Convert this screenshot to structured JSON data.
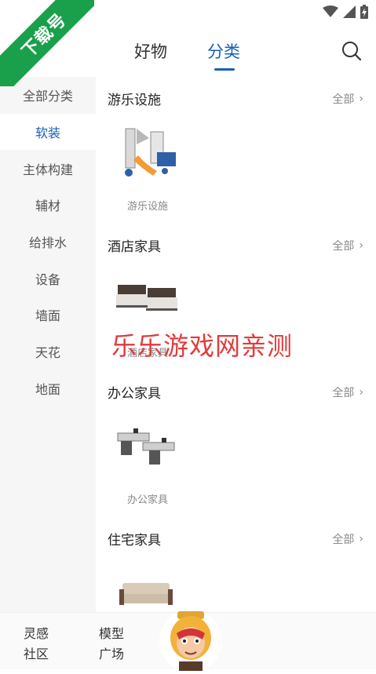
{
  "ribbon": {
    "text": "下载号",
    "color": "#1aa04a"
  },
  "status_bar": {
    "icons": [
      "wifi-icon",
      "signal-icon",
      "battery-charging-icon"
    ]
  },
  "top_tabs": [
    {
      "label": "好物",
      "active": false
    },
    {
      "label": "分类",
      "active": true
    }
  ],
  "accent_color": "#1760b8",
  "sidebar": {
    "items": [
      {
        "label": "全部分类",
        "active": false
      },
      {
        "label": "软装",
        "active": true
      },
      {
        "label": "主体构建",
        "active": false
      },
      {
        "label": "辅材",
        "active": false
      },
      {
        "label": "给排水",
        "active": false
      },
      {
        "label": "设备",
        "active": false
      },
      {
        "label": "墙面",
        "active": false
      },
      {
        "label": "天花",
        "active": false
      },
      {
        "label": "地面",
        "active": false
      }
    ]
  },
  "sections": [
    {
      "title": "游乐设施",
      "all_label": "全部",
      "item_label": "游乐设施",
      "thumb_icon": "playground-slide-image"
    },
    {
      "title": "酒店家具",
      "all_label": "全部",
      "item_label": "酒店家具",
      "thumb_icon": "hotel-beds-image"
    },
    {
      "title": "办公家具",
      "all_label": "全部",
      "item_label": "办公家具",
      "thumb_icon": "office-desks-image"
    },
    {
      "title": "住宅家具",
      "all_label": "全部",
      "item_label": "",
      "thumb_icon": "sofa-image"
    }
  ],
  "watermark": "乐乐游戏网亲测",
  "bottom_nav": [
    {
      "label": "灵感社区"
    },
    {
      "label": "模型广场"
    }
  ]
}
